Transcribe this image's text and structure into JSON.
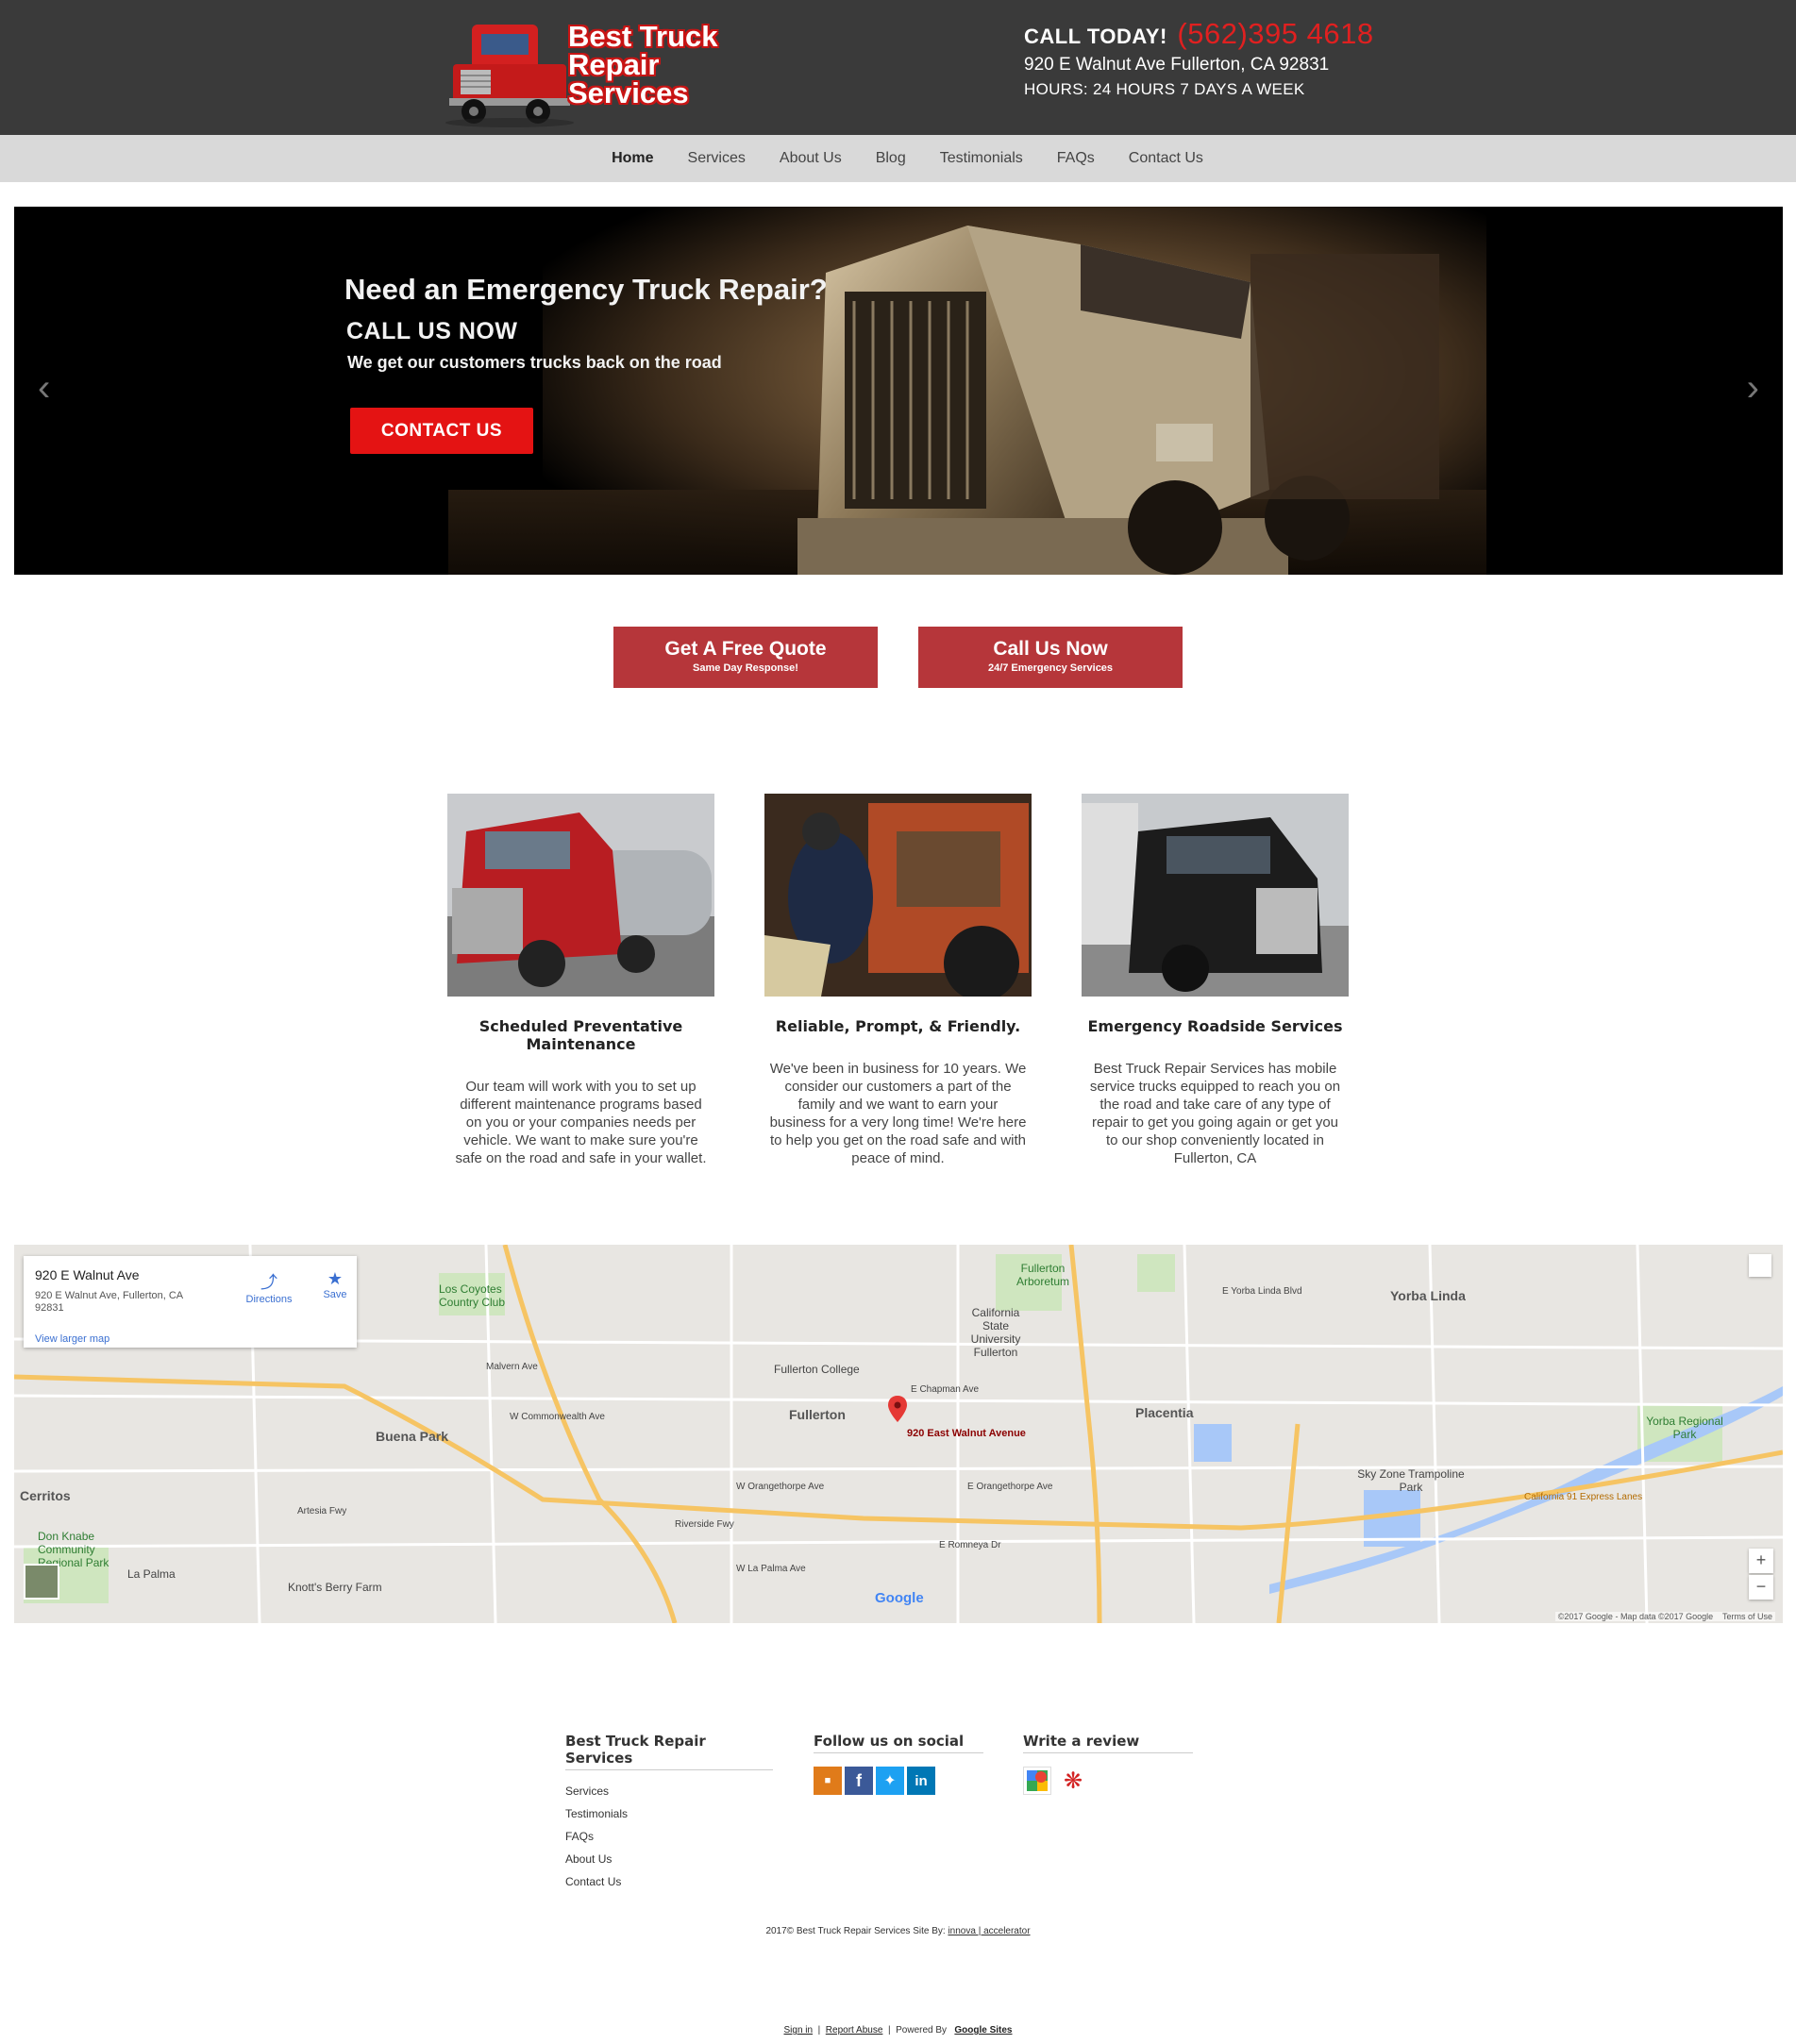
{
  "header": {
    "logo_line1": "Best Truck",
    "logo_line2": "Repair Services",
    "call_label": "CALL TODAY!",
    "phone": "(562)395 4618",
    "address": "920 E Walnut Ave Fullerton, CA 92831",
    "hours": "HOURS: 24 HOURS 7 DAYS A WEEK"
  },
  "nav": {
    "items": [
      "Home",
      "Services",
      "About Us",
      "Blog",
      "Testimonials",
      "FAQs",
      "Contact Us"
    ],
    "active": "Home"
  },
  "hero": {
    "heading": "Need an Emergency Truck Repair?",
    "subheading": "CALL US NOW",
    "text": "We get our customers trucks back on the road",
    "button": "CONTACT US",
    "prev_icon": "chevron-left-icon",
    "next_icon": "chevron-right-icon"
  },
  "cta": [
    {
      "label": "Get A Free Quote",
      "sub": "Same Day Response!"
    },
    {
      "label": "Call Us Now",
      "sub": "24/7 Emergency Services"
    }
  ],
  "features": [
    {
      "title": "Scheduled Preventative Maintenance",
      "text": "Our team will work with you to set up different maintenance programs based on you or your companies needs per vehicle. We want to make sure you're safe on the road and safe in your wallet."
    },
    {
      "title": "Reliable, Prompt, & Friendly.",
      "text": "We've been in business for 10 years. We consider our customers a part of the family and we want to earn your business for a very long time! We're here to help you get on the road safe and with peace of mind."
    },
    {
      "title": "Emergency Roadside Services",
      "text": "Best Truck Repair Services has mobile service trucks equipped to reach you on the road and take care of any type of repair to get you going again or get you to our shop conveniently located in Fullerton, CA"
    }
  ],
  "map": {
    "card_title": "920 E Walnut Ave",
    "card_address": "920 E Walnut Ave, Fullerton, CA 92831",
    "directions": "Directions",
    "save": "Save",
    "larger": "View larger map",
    "marker_label": "920 East Walnut Avenue",
    "places": [
      "Fullerton",
      "Buena Park",
      "Placentia",
      "Yorba Linda",
      "Cerritos",
      "La Palma",
      "Los Coyotes Country Club",
      "Fullerton College",
      "California State University Fullerton",
      "Fullerton Arboretum",
      "Knott's Berry Farm",
      "Sky Zone Trampoline Park",
      "Yorba Regional Park",
      "Don Knabe Community Regional Park"
    ],
    "roads": [
      "Artesia Fwy",
      "Riverside Fwy",
      "E Chapman Ave",
      "W Commonwealth Ave",
      "E Orangethorpe Ave",
      "W Orangethorpe Ave",
      "E Romneya Dr",
      "W La Palma Ave",
      "E Yorba Linda Blvd",
      "California 91 Express Lanes",
      "Malvern Ave"
    ],
    "attribution": "©2017 Google - Map data ©2017 Google",
    "terms": "Terms of Use",
    "google": "Google"
  },
  "footer": {
    "col1_title": "Best Truck Repair Services",
    "col1_links": [
      "Services",
      "Testimonials",
      "FAQs",
      "About Us",
      "Contact Us"
    ],
    "col2_title": "Follow us on social",
    "col3_title": "Write a review",
    "copyright": "2017© Best Truck Repair Services Site By:",
    "credit": "innova | accelerator",
    "sign_in": "Sign in",
    "report": "Report Abuse",
    "powered": "Powered By",
    "google_sites": "Google Sites"
  },
  "colors": {
    "header_bg": "#3a3a3a",
    "nav_bg": "#d9d9d9",
    "phone": "#e02020",
    "cta_bg": "#b6363a",
    "hero_button": "#e41313"
  }
}
